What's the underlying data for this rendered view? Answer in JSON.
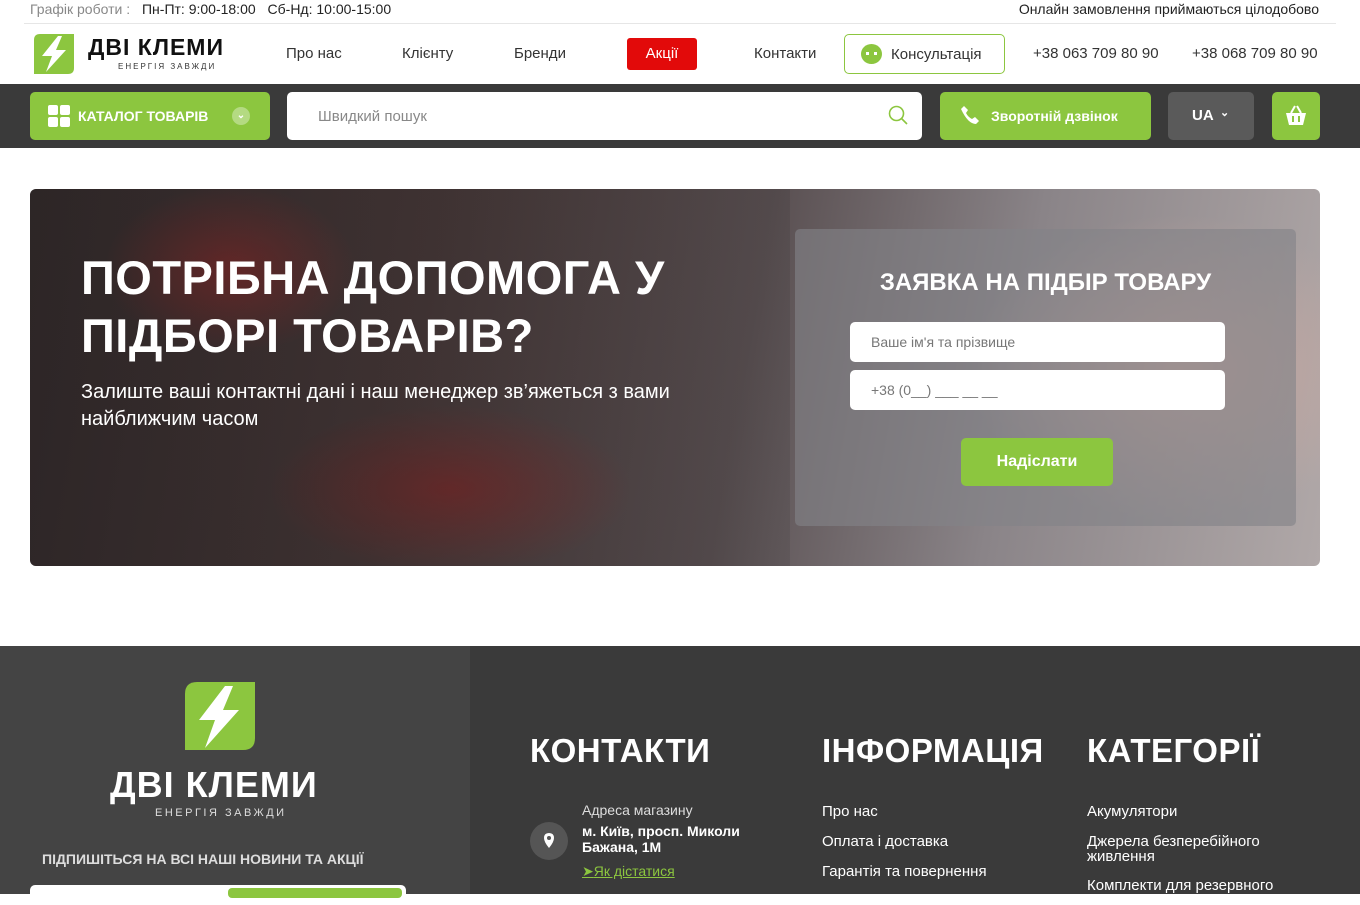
{
  "topbar": {
    "schedule_label": "Графік роботи :",
    "weekdays": "Пн-Пт: 9:00-18:00",
    "weekend": "Сб-Нд: 10:00-15:00",
    "online": "Онлайн замовлення приймаються цілодобово"
  },
  "header": {
    "logo_text": "ДВІ КЛЕМИ",
    "logo_sub": "ЕНЕРГІЯ ЗАВЖДИ",
    "nav": [
      "Про нас",
      "Клієнту",
      "Бренди",
      "Акції",
      "Контакти"
    ],
    "consult": "Консультація",
    "phone1": "+38 063 709 80 90",
    "phone2": "+38 068 709 80 90"
  },
  "toolbar": {
    "catalog": "КАТАЛОГ ТОВАРІВ",
    "search_placeholder": "Швидкий пошук",
    "callback": "Зворотній дзвінок",
    "lang": "UA",
    "cart_icon": "basket-icon"
  },
  "hero": {
    "title": "ПОТРІБНА ДОПОМОГА У ПІДБОРІ ТОВАРІВ?",
    "text": "Залиште ваші контактні дані і наш менеджер зв’яжеться з вами найближчим часом",
    "form_title": "ЗАЯВКА НА ПІДБІР ТОВАРУ",
    "name_placeholder": "Ваше ім'я та прізвище",
    "phone_placeholder": "+38 (0__) ___ __ __",
    "submit": "Надіслати"
  },
  "footer": {
    "logo_text": "ДВІ КЛЕМИ",
    "logo_sub": "ЕНЕРГІЯ ЗАВЖДИ",
    "subscribe": "ПІДПИШІТЬСЯ НА ВСІ НАШІ НОВИНИ ТА АКЦІЇ",
    "contacts_title": "КОНТАКТИ",
    "address_label": "Адреса магазину",
    "address_value": "м. Київ, просп. Миколи Бажана, 1М",
    "route": "Як дістатися",
    "info_title": "ІНФОРМАЦІЯ",
    "info_links": [
      "Про нас",
      "Оплата і доставка",
      "Гарантія та повернення"
    ],
    "categories_title": "КАТЕГОРІЇ",
    "category_links": [
      "Акумулятори",
      "Джерела безперебійного живлення",
      "Комплекти для резервного"
    ]
  },
  "colors": {
    "accent": "#8cc63f",
    "promo": "#e20a0a",
    "dark": "#3a3a3a"
  }
}
